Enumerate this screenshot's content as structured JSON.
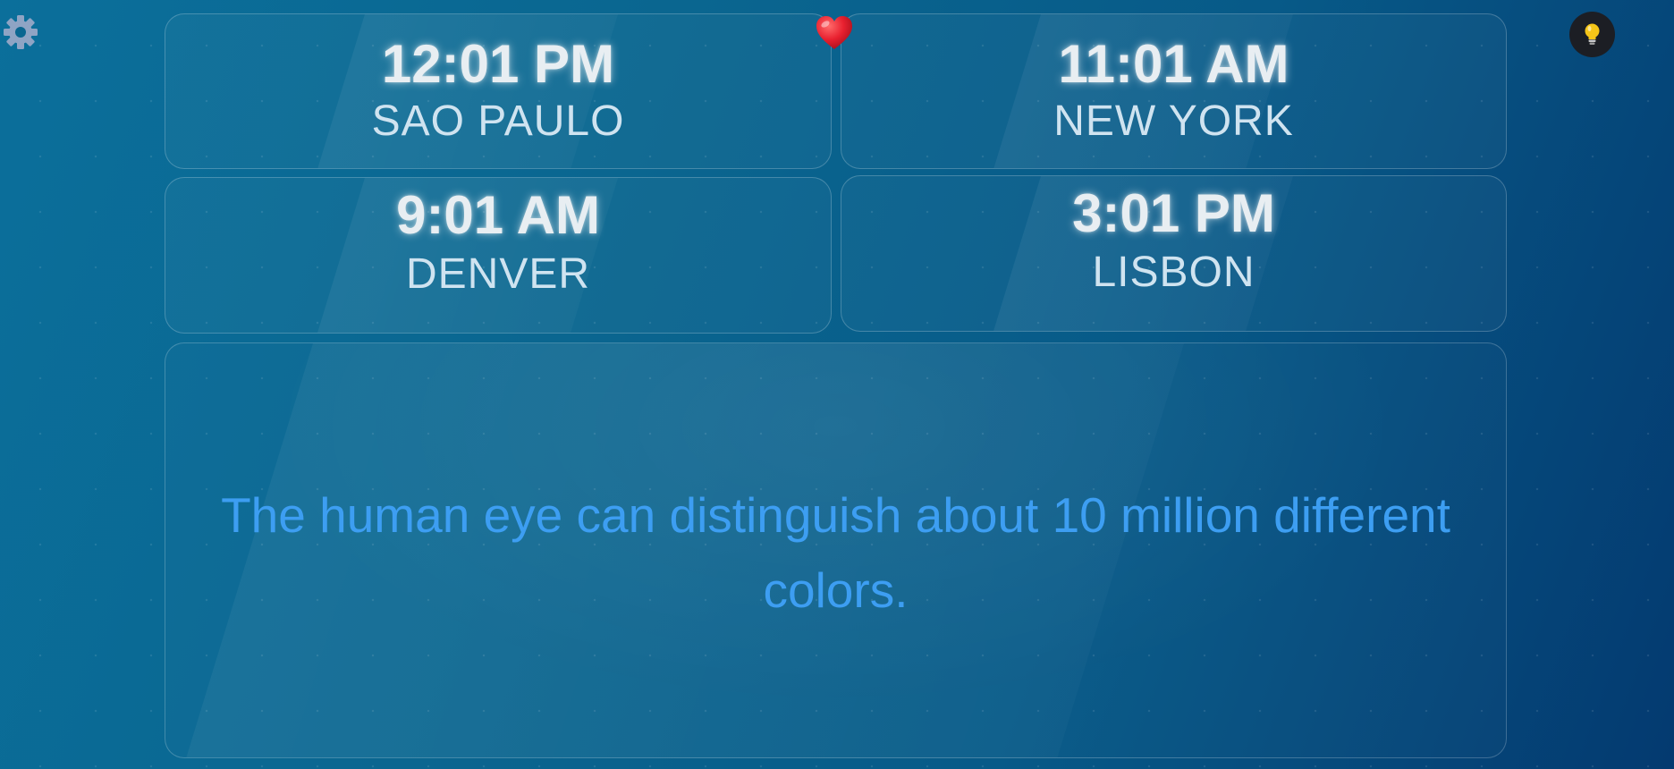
{
  "toolbar": {
    "settings_icon": "gear-icon",
    "favorite_icon": "heart-icon",
    "tip_icon": "lightbulb-icon"
  },
  "clocks": [
    {
      "time": "12:01 PM",
      "city": "SAO PAULO"
    },
    {
      "time": "11:01 AM",
      "city": "NEW YORK"
    },
    {
      "time": "9:01 AM",
      "city": "DENVER"
    },
    {
      "time": "3:01 PM",
      "city": "LISBON"
    }
  ],
  "fact": {
    "text": "The human eye can distinguish about 10 million different colors."
  },
  "colors": {
    "fact_text": "#3d9ef2",
    "heart": "#e8202f",
    "bulb": "#f5c518"
  }
}
